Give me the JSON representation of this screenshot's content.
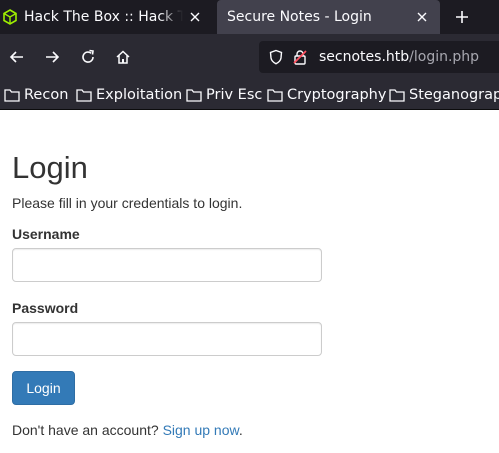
{
  "browser": {
    "tabs": [
      {
        "title": "Hack The Box :: Hack The Box",
        "active": false
      },
      {
        "title": "Secure Notes - Login",
        "active": true
      }
    ],
    "url": {
      "host": "secnotes.htb",
      "path": "/login.php"
    },
    "bookmarks": [
      "Recon",
      "Exploitation",
      "Priv Esc",
      "Cryptography",
      "Steganography"
    ]
  },
  "page": {
    "title": "Login",
    "subtitle": "Please fill in your credentials to login.",
    "username_label": "Username",
    "username_value": "",
    "password_label": "Password",
    "password_value": "",
    "login_button": "Login",
    "signup_prompt": "Don't have an account?",
    "signup_link": "Sign up now",
    "signup_suffix": "."
  },
  "colors": {
    "tabbar": "#1c1b22",
    "toolbar": "#2b2a33",
    "active_tab": "#42414d",
    "htb_green": "#9fef00",
    "primary": "#337ab7",
    "text": "#333333"
  }
}
